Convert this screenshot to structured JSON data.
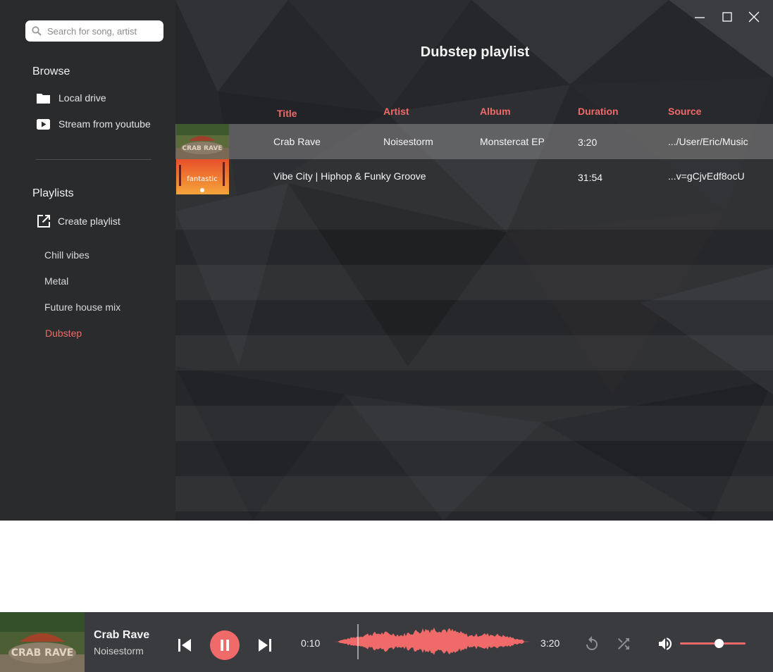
{
  "search": {
    "placeholder": "Search for song, artist"
  },
  "browse": {
    "title": "Browse",
    "items": [
      {
        "label": "Local drive",
        "icon": "folder-icon"
      },
      {
        "label": "Stream from youtube",
        "icon": "youtube-icon"
      }
    ]
  },
  "playlists": {
    "title": "Playlists",
    "create_label": "Create playlist",
    "items": [
      {
        "label": "Chill vibes"
      },
      {
        "label": "Metal"
      },
      {
        "label": "Future house mix"
      },
      {
        "label": "Dubstep",
        "active": true
      }
    ]
  },
  "main": {
    "title": "Dubstep playlist",
    "columns": [
      "Title",
      "Artist",
      "Album",
      "Duration",
      "Source"
    ],
    "tracks": [
      {
        "title": "Crab Rave",
        "artist": "Noisestorm",
        "album": "Monstercat EP",
        "duration": "3:20",
        "source": ".../User/Eric/Music",
        "thumb_text": "CRAB RAVE",
        "selected": true
      },
      {
        "title": "Vibe City | Hiphop & Funky Groove",
        "artist": "",
        "album": "",
        "duration": "31:54",
        "source": "...v=gCjvEdf8ocU",
        "thumb_text": "fantastic",
        "selected": false
      }
    ]
  },
  "player": {
    "title": "Crab Rave",
    "artist": "Noisestorm",
    "art_text": "CRAB RAVE",
    "elapsed": "0:10",
    "total": "3:20",
    "progress": 0.05,
    "volume": 0.6
  },
  "colors": {
    "accent": "#f06a6a",
    "sidebar": "#2a2b2d",
    "player": "#3a3b3e"
  }
}
